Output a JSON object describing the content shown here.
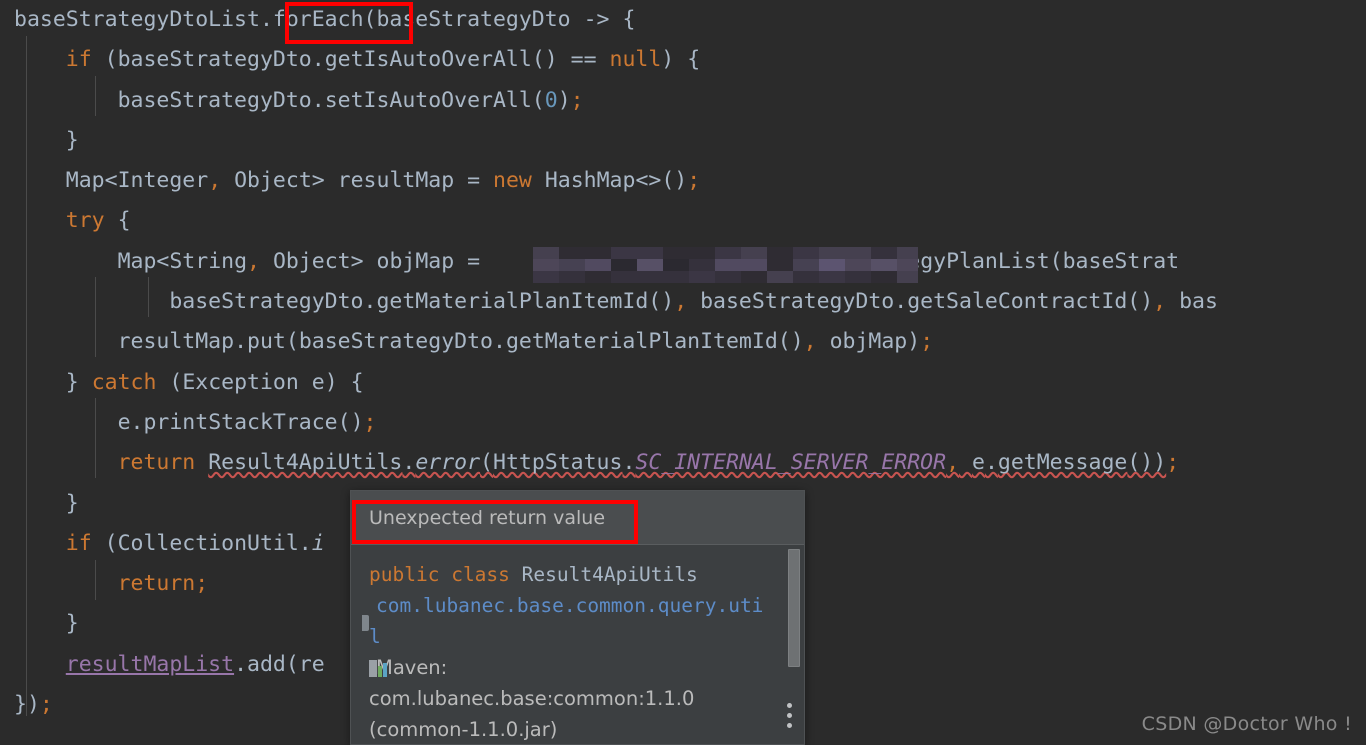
{
  "editor": {
    "background_color": "#2b2b2b",
    "language": "Java",
    "lines": [
      {
        "indent": 0,
        "html": "<span class=\"pl\">baseStrategyDtoList</span><span class=\"punc\">.</span><span class=\"pl\">forEach</span><span class=\"punc\">(</span><span class=\"pl\">baseStrategyDto</span> <span class=\"punc\">-&gt;</span> <span class=\"punc\">{</span>"
      },
      {
        "indent": 1,
        "html": "<span class=\"kw\">if</span> <span class=\"punc\">(</span><span class=\"pl\">baseStrategyDto</span><span class=\"punc\">.</span><span class=\"pl\">getIsAutoOverAll</span><span class=\"punc\">()</span> <span class=\"punc\">==</span> <span class=\"kw\">null</span><span class=\"punc\">)</span> <span class=\"punc\">{</span>"
      },
      {
        "indent": 2,
        "html": "<span class=\"pl\">baseStrategyDto</span><span class=\"punc\">.</span><span class=\"pl\">setIsAutoOverAll</span><span class=\"punc\">(</span><span class=\"num\">0</span><span class=\"punc\">)</span><span class=\"semi\">;</span>"
      },
      {
        "indent": 1,
        "html": "<span class=\"punc\">}</span>"
      },
      {
        "indent": 1,
        "html": "<span class=\"pl\">Map</span><span class=\"punc\">&lt;</span><span class=\"pl\">Integer</span><span class=\"semi\">,</span> <span class=\"pl\">Object</span><span class=\"punc\">&gt;</span> <span class=\"pl\">resultMap</span> <span class=\"punc\">=</span> <span class=\"kw\">new</span> <span class=\"pl\">HashMap</span><span class=\"punc\">&lt;&gt;()</span><span class=\"semi\">;</span>"
      },
      {
        "indent": 1,
        "html": "<span class=\"kw\">try</span> <span class=\"punc\">{</span>"
      },
      {
        "indent": 2,
        "html": "<span class=\"pl\">Map</span><span class=\"punc\">&lt;</span><span class=\"pl\">String</span><span class=\"semi\">,</span> <span class=\"pl\">Object</span><span class=\"punc\">&gt;</span> <span class=\"pl\">objMap</span> <span class=\"punc\">=</span> <span style=\"opacity:0\">xxxxxxxxxxxxxxxxxxxxx</span><span class=\"pl\">verallStrategyPlanList</span><span class=\"punc\">(</span><span class=\"pl\">baseStrat</span>"
      },
      {
        "indent": 3,
        "html": "<span class=\"pl\">baseStrategyDto</span><span class=\"punc\">.</span><span class=\"pl\">getMaterialPlanItemId</span><span class=\"punc\">()</span><span class=\"semi\">,</span> <span class=\"pl\">baseStrategyDto</span><span class=\"punc\">.</span><span class=\"pl\">getSaleContractId</span><span class=\"punc\">()</span><span class=\"semi\">,</span> <span class=\"pl\">bas</span>"
      },
      {
        "indent": 2,
        "html": "<span class=\"pl\">resultMap</span><span class=\"punc\">.</span><span class=\"pl\">put</span><span class=\"punc\">(</span><span class=\"pl\">baseStrategyDto</span><span class=\"punc\">.</span><span class=\"pl\">getMaterialPlanItemId</span><span class=\"punc\">()</span><span class=\"semi\">,</span> <span class=\"pl\">objMap</span><span class=\"punc\">)</span><span class=\"semi\">;</span>"
      },
      {
        "indent": 1,
        "html": "<span class=\"punc\">}</span> <span class=\"kw\">catch</span> <span class=\"punc\">(</span><span class=\"pl\">Exception</span> <span class=\"pl\">e</span><span class=\"punc\">)</span> <span class=\"punc\">{</span>"
      },
      {
        "indent": 2,
        "html": "<span class=\"pl\">e</span><span class=\"punc\">.</span><span class=\"pl\">printStackTrace</span><span class=\"punc\">()</span><span class=\"semi\">;</span>"
      },
      {
        "indent": 2,
        "html": "<span class=\"kw\">return</span> <span class=\"err\"><span class=\"pl\">Result4ApiUtils</span><span class=\"punc\">.</span><span class=\"mth\">error</span><span class=\"punc\">(</span><span class=\"pl\">HttpStatus</span><span class=\"punc\">.</span><span class=\"stat\">SC_INTERNAL_SERVER_ERROR</span><span class=\"semi\">,</span> <span class=\"pl\">e</span><span class=\"punc\">.</span><span class=\"pl\">getMessage</span><span class=\"punc\">())</span></span><span class=\"semi\">;</span>"
      },
      {
        "indent": 1,
        "html": "<span class=\"punc\">}</span>"
      },
      {
        "indent": 1,
        "html": "<span class=\"kw\">if</span> <span class=\"punc\">(</span><span class=\"pl\">CollectionUtil</span><span class=\"punc\">.</span><span class=\"mth\">i</span>"
      },
      {
        "indent": 2,
        "html": "<span class=\"kw\">return</span><span class=\"semi\">;</span>"
      },
      {
        "indent": 1,
        "html": "<span class=\"punc\">}</span>"
      },
      {
        "indent": 1,
        "html": "<span class=\"fld\">resultMapList</span><span class=\"punc\">.</span><span class=\"pl\">add</span><span class=\"punc\">(</span><span class=\"pl\">re</span>"
      },
      {
        "indent": 0,
        "html": "<span class=\"punc\">})</span><span class=\"semi\">;</span>"
      }
    ],
    "plain_lines": [
      "baseStrategyDtoList.forEach(baseStrategyDto -> {",
      "    if (baseStrategyDto.getIsAutoOverAll() == null) {",
      "        baseStrategyDto.setIsAutoOverAll(0);",
      "    }",
      "    Map<Integer, Object> resultMap = new HashMap<>();",
      "    try {",
      "        Map<String, Object> objMap = ████████████verallStrategyPlanList(baseStrat",
      "            baseStrategyDto.getMaterialPlanItemId(), baseStrategyDto.getSaleContractId(), bas",
      "        resultMap.put(baseStrategyDto.getMaterialPlanItemId(), objMap);",
      "    } catch (Exception e) {",
      "        e.printStackTrace();",
      "        return Result4ApiUtils.error(HttpStatus.SC_INTERNAL_SERVER_ERROR, e.getMessage());",
      "    }",
      "    if (CollectionUtil.i",
      "        return;",
      "    }",
      "    resultMapList.add(re",
      "});"
    ]
  },
  "redaction": {
    "label": "pixelated-redacted-code"
  },
  "annotations": {
    "color": "#fe0000",
    "foreach_box_target": "forEach(",
    "tooltip_box_target": "Unexpected return value"
  },
  "tooltip": {
    "header_text": "Unexpected return value",
    "signature": {
      "keyword1": "public",
      "keyword2": "class",
      "class_name": "Result4ApiUtils"
    },
    "package_icon": "package-folder-icon",
    "package": "com.lubanec.base.common.query.util",
    "maven_icon": "maven-icon",
    "maven_label": "Maven:",
    "maven_coordinates": "com.lubanec.base:common:1.1.0",
    "maven_jar": "(common-1.1.0.jar)",
    "more_options_icon": "kebab-menu-icon",
    "scrollbar": "vertical-scrollbar"
  },
  "watermark": {
    "text": "CSDN @Doctor Who !"
  }
}
